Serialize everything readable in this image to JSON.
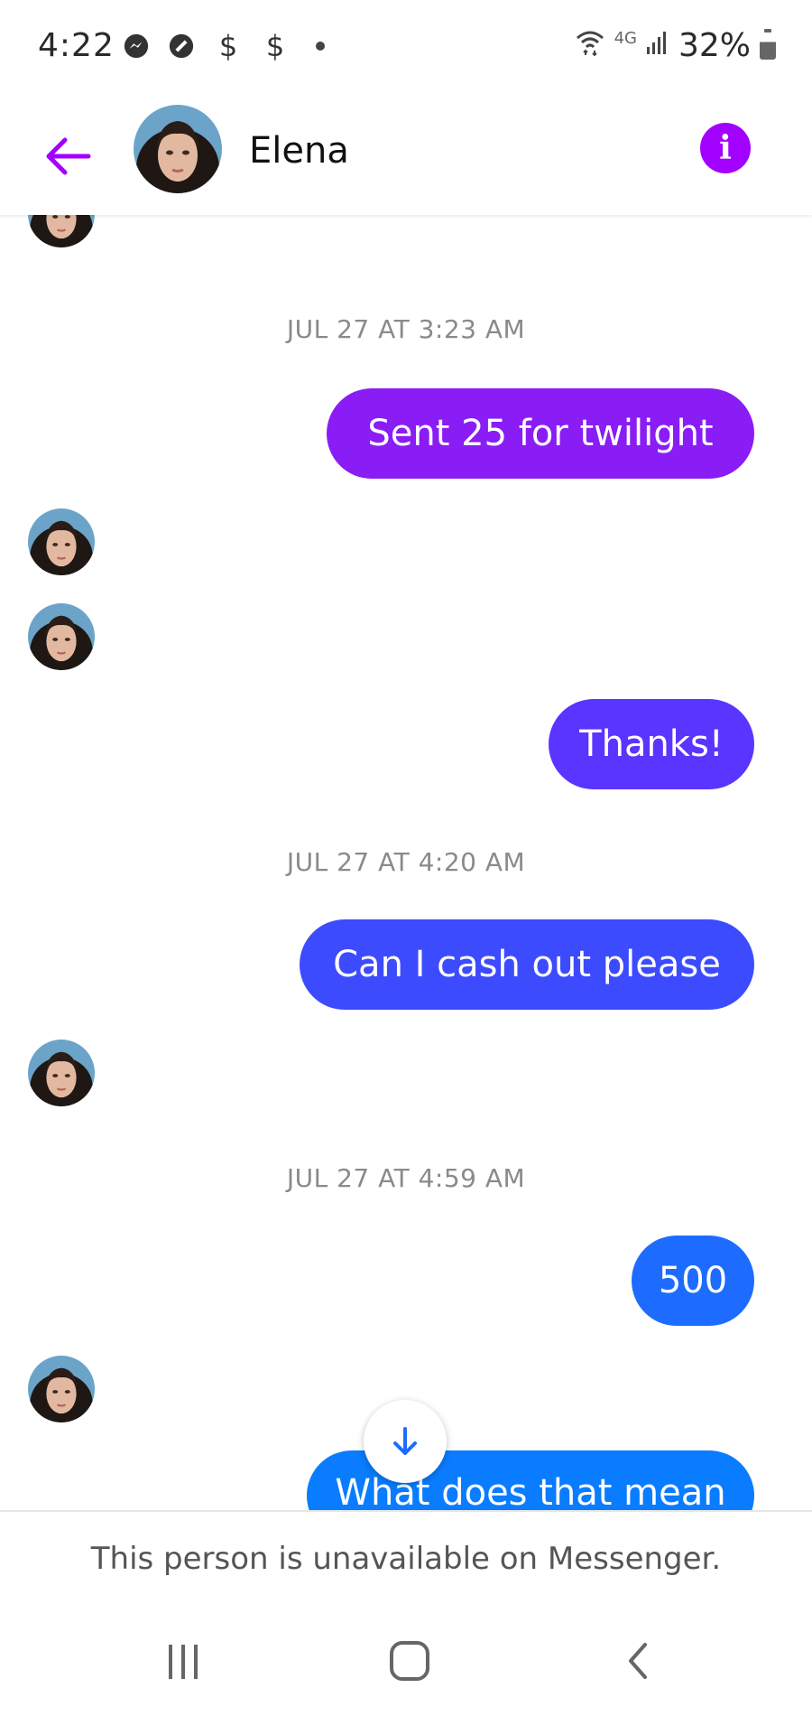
{
  "status_bar": {
    "time": "4:22",
    "network": "4G",
    "battery": "32%",
    "icons": [
      "messenger-icon",
      "no-disturb-icon",
      "dollar-icon",
      "dollar-icon",
      "dot-icon",
      "wifi-icon",
      "signal-icon",
      "battery-icon"
    ],
    "dollar_1": "$",
    "dollar_2": "$"
  },
  "header": {
    "contact_name": "Elena",
    "back_icon": "back-arrow-icon",
    "info_icon": "info-icon",
    "info_glyph": "i",
    "accent_color": "#a200ff"
  },
  "conversation": {
    "timestamps": [
      "JUL 27 AT 3:23 AM",
      "JUL 27 AT 4:20 AM",
      "JUL 27 AT 4:59 AM"
    ],
    "messages": [
      {
        "text": "Sent 25 for twilight",
        "color": "#8a1cf5"
      },
      {
        "text": "Thanks!",
        "color": "#5a35ff"
      },
      {
        "text": "Can I cash out please",
        "color": "#3d4bff"
      },
      {
        "text": "500",
        "color": "#1d6cff"
      },
      {
        "text": "What does that mean",
        "color": "#0a7cff"
      }
    ]
  },
  "footer": {
    "notice": "This person is unavailable on Messenger."
  },
  "nav": {
    "recents": "recents-icon",
    "home": "home-icon",
    "back": "back-icon"
  }
}
